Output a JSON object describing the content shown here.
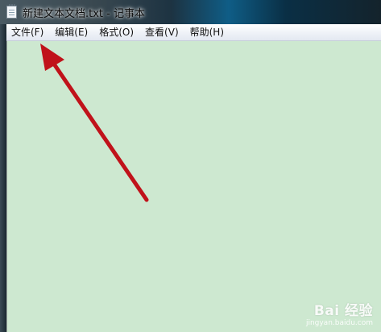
{
  "window": {
    "title": "新建文本文档.txt - 记事本",
    "icon": "notepad-icon"
  },
  "menubar": {
    "items": [
      {
        "name": "file",
        "label": "文件(F)"
      },
      {
        "name": "edit",
        "label": "编辑(E)"
      },
      {
        "name": "format",
        "label": "格式(O)"
      },
      {
        "name": "view",
        "label": "查看(V)"
      },
      {
        "name": "help",
        "label": "帮助(H)"
      }
    ]
  },
  "editor": {
    "content": "",
    "background_color": "#cde8d0"
  },
  "annotation": {
    "arrow_color": "#c0121a",
    "points_to": "file"
  },
  "watermark": {
    "main": "Bai 经验",
    "sub": "jingyan.baidu.com"
  }
}
